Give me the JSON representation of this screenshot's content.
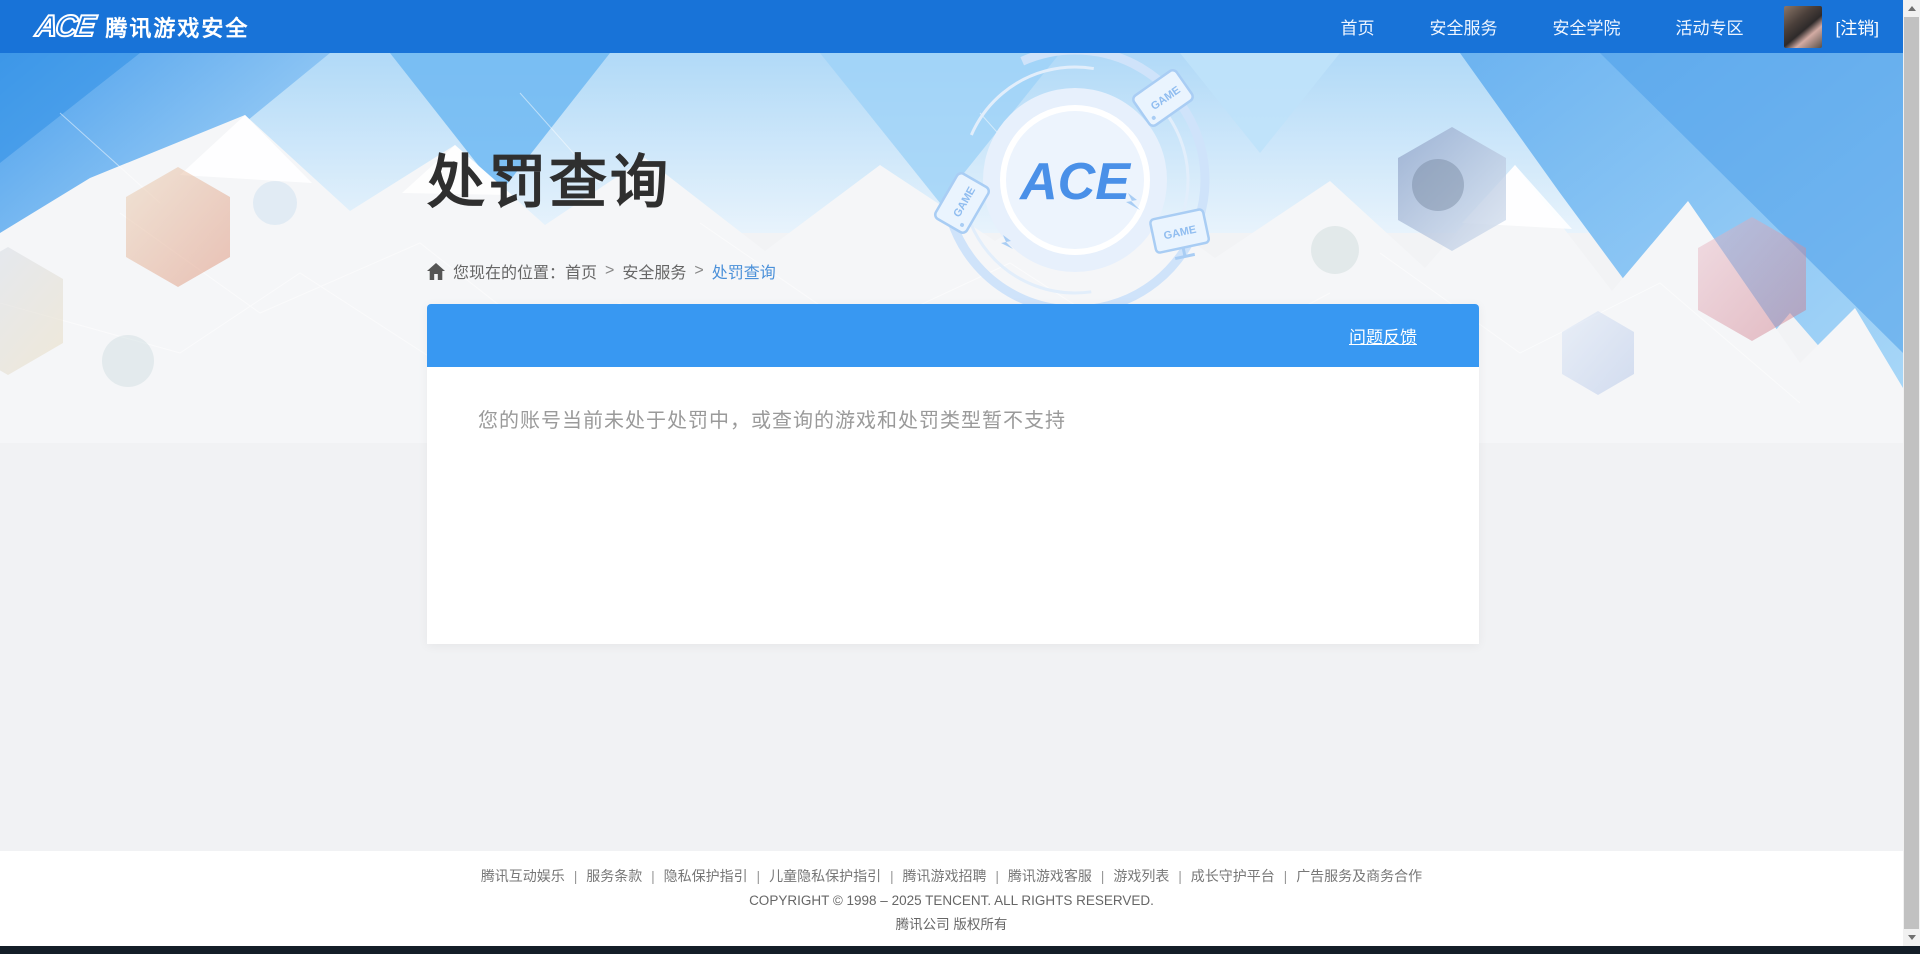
{
  "nav": {
    "logo_text": "ACE",
    "brand": "腾讯游戏安全",
    "items": [
      {
        "label": "首页"
      },
      {
        "label": "安全服务"
      },
      {
        "label": "安全学院"
      },
      {
        "label": "活动专区"
      }
    ],
    "logout_label": "[注销]"
  },
  "banner": {
    "title": "处罚查询",
    "ace_emblem_text": "ACE",
    "game_chip_label": "GAME",
    "breadcrumb": {
      "prefix": "您现在的位置：",
      "home": "首页",
      "separator": ">",
      "section": "安全服务",
      "current": "处罚查询"
    }
  },
  "card": {
    "feedback_label": "问题反馈",
    "message": "您的账号当前未处于处罚中，或查询的游戏和处罚类型暂不支持"
  },
  "footer": {
    "links": [
      "腾讯互动娱乐",
      "服务条款",
      "隐私保护指引",
      "儿童隐私保护指引",
      "腾讯游戏招聘",
      "腾讯游戏客服",
      "游戏列表",
      "成长守护平台",
      "广告服务及商务合作"
    ],
    "separator": "|",
    "copyright": "COPYRIGHT © 1998 – 2025 TENCENT. ALL RIGHTS RESERVED.",
    "company": "腾讯公司 版权所有"
  },
  "colors": {
    "topbar_blue": "#1873d8",
    "card_header_blue": "#3898f2",
    "breadcrumb_link_blue": "#4a90d9",
    "title_dark": "#2f2f2f",
    "message_gray": "#9a9a9a"
  }
}
